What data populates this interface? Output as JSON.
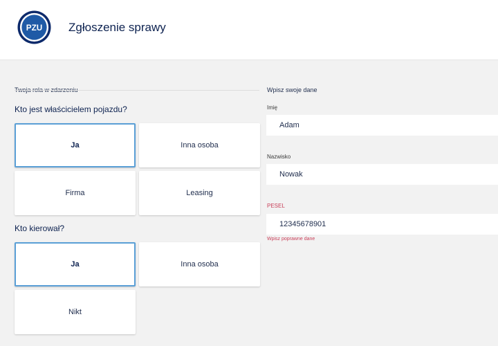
{
  "header": {
    "logo_text": "PZU",
    "title": "Zgłoszenie sprawy"
  },
  "role_section": {
    "label": "Twoja rola w zdarzeniu",
    "owner_question": "Kto jest właścicielem pojazdu?",
    "owner_options": [
      "Ja",
      "Inna osoba",
      "Firma",
      "Leasing"
    ],
    "owner_selected": "Ja",
    "driver_question": "Kto kierował?",
    "driver_options": [
      "Ja",
      "Inna osoba",
      "Nikt"
    ],
    "driver_selected": "Ja"
  },
  "data_section": {
    "label": "Wpisz swoje dane",
    "first_name_label": "Imię",
    "first_name_value": "Adam",
    "last_name_label": "Nazwisko",
    "last_name_value": "Nowak",
    "pesel_label": "PESEL",
    "pesel_value": "12345678901",
    "pesel_error": "Wpisz poprawne dane"
  },
  "colors": {
    "brand_navy": "#0d2250",
    "selected_border": "#5a9fd6",
    "error": "#c9415a",
    "background": "#f2f2f2"
  }
}
